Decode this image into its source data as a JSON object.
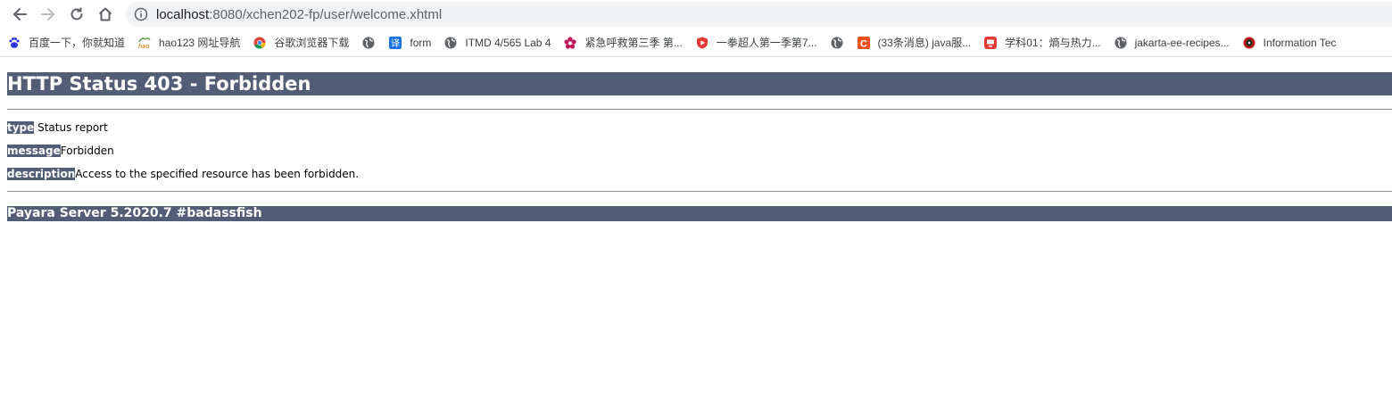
{
  "browser": {
    "url_host": "localhost",
    "url_rest": ":8080/xchen202-fp/user/welcome.xhtml",
    "bookmarks": [
      {
        "icon": "baidu-paw-icon",
        "label": "百度一下，你就知道"
      },
      {
        "icon": "hao123-icon",
        "label": "hao123 网址导航"
      },
      {
        "icon": "chrome-icon",
        "label": "谷歌浏览器下载"
      },
      {
        "icon": "globe-icon",
        "label": ""
      },
      {
        "icon": "translate-icon",
        "label": "form"
      },
      {
        "icon": "globe-icon",
        "label": "ITMD 4/565 Lab 4"
      },
      {
        "icon": "flower-icon",
        "label": "紧急呼救第三季 第..."
      },
      {
        "icon": "shield-play-icon",
        "label": "一拳超人第一季第7..."
      },
      {
        "icon": "globe-icon",
        "label": ""
      },
      {
        "icon": "csdn-icon",
        "label": "(33条消息) java服..."
      },
      {
        "icon": "app-red-icon",
        "label": "学科01：熵与热力..."
      },
      {
        "icon": "globe-icon",
        "label": "jakarta-ee-recipes..."
      },
      {
        "icon": "info-tech-icon",
        "label": "Information Tec"
      }
    ]
  },
  "page": {
    "title": "HTTP Status 403 - Forbidden",
    "type_label": "type",
    "type_value": " Status report",
    "message_label": "message",
    "message_value": "Forbidden",
    "description_label": "description",
    "description_value": "Access to the specified resource has been forbidden.",
    "footer": "Payara Server 5.2020.7 #badassfish"
  },
  "colors": {
    "header_bg": "#525d76",
    "header_text": "#ffffff"
  }
}
